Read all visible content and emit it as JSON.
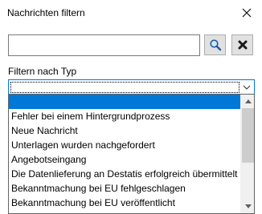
{
  "window": {
    "title": "Nachrichten filtern",
    "close_icon": "close-x-icon"
  },
  "search": {
    "value": "",
    "placeholder": "",
    "search_icon": "magnifier-icon",
    "clear_icon": "delete-x-icon"
  },
  "filter": {
    "label": "Filtern nach Typ",
    "selected_value": "",
    "dropdown_arrow_icon": "chevron-down-icon",
    "options": [
      "",
      "Fehler bei einem Hintergrundprozess",
      "Neue Nachricht",
      "Unterlagen wurden nachgefordert",
      "Angebotseingang",
      "Die Datenlieferung an Destatis erfolgreich übermittelt",
      "Bekanntmachung bei EU fehlgeschlagen",
      "Bekanntmachung bei EU veröffentlicht"
    ],
    "highlighted_index": 0
  },
  "colors": {
    "accent": "#0078d7",
    "clear_icon": "#1a1a1a",
    "search_icon": "#1f5d9e"
  }
}
